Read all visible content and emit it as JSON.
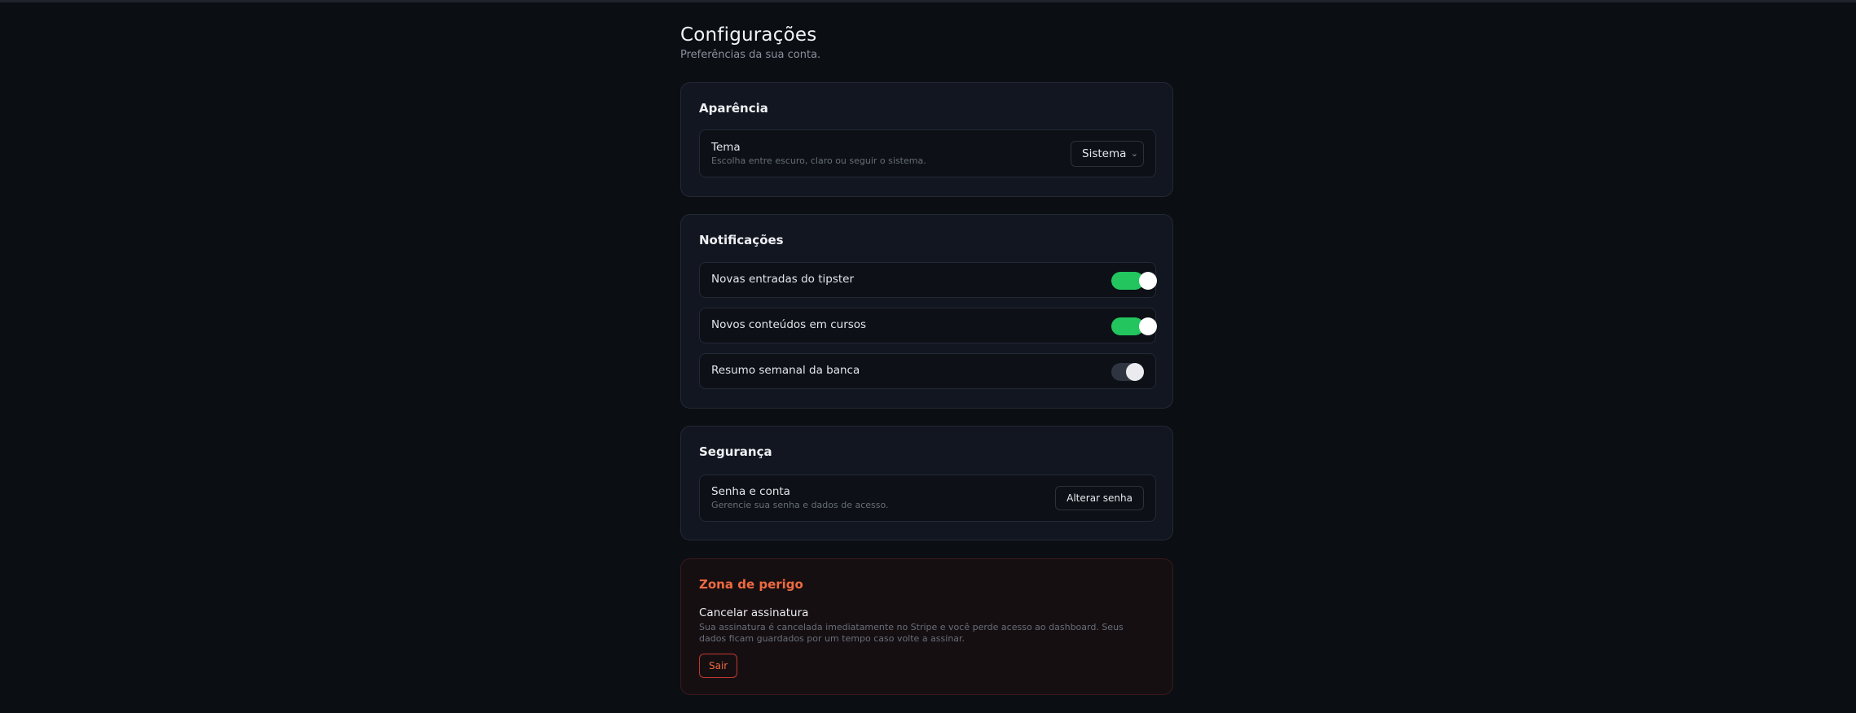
{
  "page": {
    "title": "Configurações",
    "subtitle": "Preferências da sua conta."
  },
  "appearance": {
    "title": "Aparência",
    "theme": {
      "label": "Tema",
      "description": "Escolha entre escuro, claro ou seguir o sistema.",
      "selected": "Sistema"
    }
  },
  "notifications": {
    "title": "Notificações",
    "items": [
      {
        "label": "Novas entradas do tipster",
        "enabled": true
      },
      {
        "label": "Novos conteúdos em cursos",
        "enabled": true
      },
      {
        "label": "Resumo semanal da banca",
        "enabled": false
      }
    ]
  },
  "security": {
    "title": "Segurança",
    "account": {
      "label": "Senha e conta",
      "description": "Gerencie sua senha e dados de acesso.",
      "button": "Alterar senha"
    }
  },
  "danger": {
    "title": "Zona de perigo",
    "label": "Cancelar assinatura",
    "description": "Sua assinatura é cancelada imediatamente no Stripe e você perde acesso ao dashboard. Seus dados ficam guardados por um tempo caso volte a assinar.",
    "button": "Sair"
  },
  "colors": {
    "background": "#0b0e13",
    "card": "#121620",
    "toggle_on": "#22c55e",
    "danger_accent": "#ee6a3f"
  },
  "icons": {
    "select_chevron": "chevron-down-icon"
  }
}
